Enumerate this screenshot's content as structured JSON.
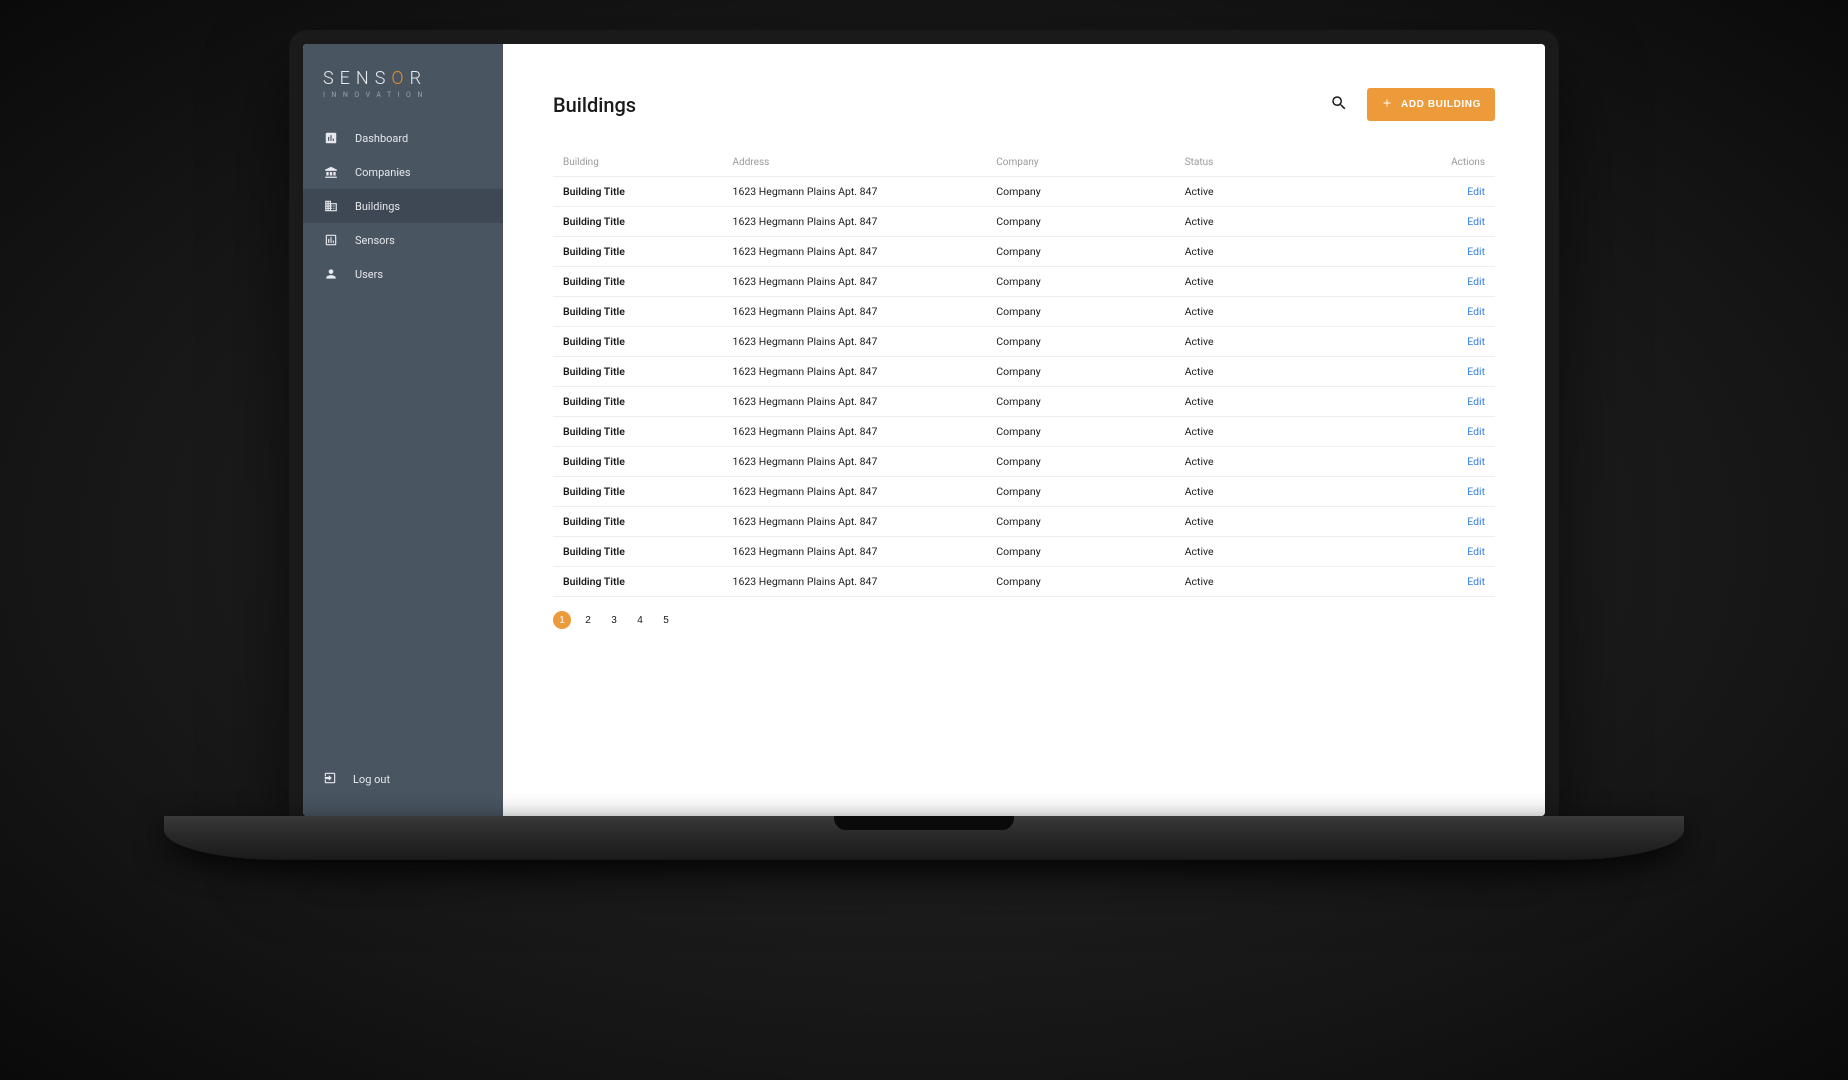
{
  "brand": {
    "main_pre": "SENS",
    "main_accent": "O",
    "main_post": "R",
    "sub": "INNOVATION"
  },
  "sidebar": {
    "items": [
      {
        "label": "Dashboard",
        "active": false
      },
      {
        "label": "Companies",
        "active": false
      },
      {
        "label": "Buildings",
        "active": true
      },
      {
        "label": "Sensors",
        "active": false
      },
      {
        "label": "Users",
        "active": false
      }
    ],
    "logout_label": "Log out"
  },
  "page": {
    "title": "Buildings",
    "add_button_label": "ADD BUILDING"
  },
  "table": {
    "headers": {
      "building": "Building",
      "address": "Address",
      "company": "Company",
      "status": "Status",
      "actions": "Actions"
    },
    "edit_label": "Edit",
    "rows": [
      {
        "title": "Building Title",
        "address": "1623 Hegmann Plains Apt. 847",
        "company": "Company",
        "status": "Active"
      },
      {
        "title": "Building Title",
        "address": "1623 Hegmann Plains Apt. 847",
        "company": "Company",
        "status": "Active"
      },
      {
        "title": "Building Title",
        "address": "1623 Hegmann Plains Apt. 847",
        "company": "Company",
        "status": "Active"
      },
      {
        "title": "Building Title",
        "address": "1623 Hegmann Plains Apt. 847",
        "company": "Company",
        "status": "Active"
      },
      {
        "title": "Building Title",
        "address": "1623 Hegmann Plains Apt. 847",
        "company": "Company",
        "status": "Active"
      },
      {
        "title": "Building Title",
        "address": "1623 Hegmann Plains Apt. 847",
        "company": "Company",
        "status": "Active"
      },
      {
        "title": "Building Title",
        "address": "1623 Hegmann Plains Apt. 847",
        "company": "Company",
        "status": "Active"
      },
      {
        "title": "Building Title",
        "address": "1623 Hegmann Plains Apt. 847",
        "company": "Company",
        "status": "Active"
      },
      {
        "title": "Building Title",
        "address": "1623 Hegmann Plains Apt. 847",
        "company": "Company",
        "status": "Active"
      },
      {
        "title": "Building Title",
        "address": "1623 Hegmann Plains Apt. 847",
        "company": "Company",
        "status": "Active"
      },
      {
        "title": "Building Title",
        "address": "1623 Hegmann Plains Apt. 847",
        "company": "Company",
        "status": "Active"
      },
      {
        "title": "Building Title",
        "address": "1623 Hegmann Plains Apt. 847",
        "company": "Company",
        "status": "Active"
      },
      {
        "title": "Building Title",
        "address": "1623 Hegmann Plains Apt. 847",
        "company": "Company",
        "status": "Active"
      },
      {
        "title": "Building Title",
        "address": "1623 Hegmann Plains Apt. 847",
        "company": "Company",
        "status": "Active"
      }
    ]
  },
  "pagination": {
    "pages": [
      "1",
      "2",
      "3",
      "4",
      "5"
    ],
    "active": "1"
  },
  "colors": {
    "accent": "#ed9a3a",
    "sidebar": "#4a5562",
    "link": "#2f7de1"
  }
}
